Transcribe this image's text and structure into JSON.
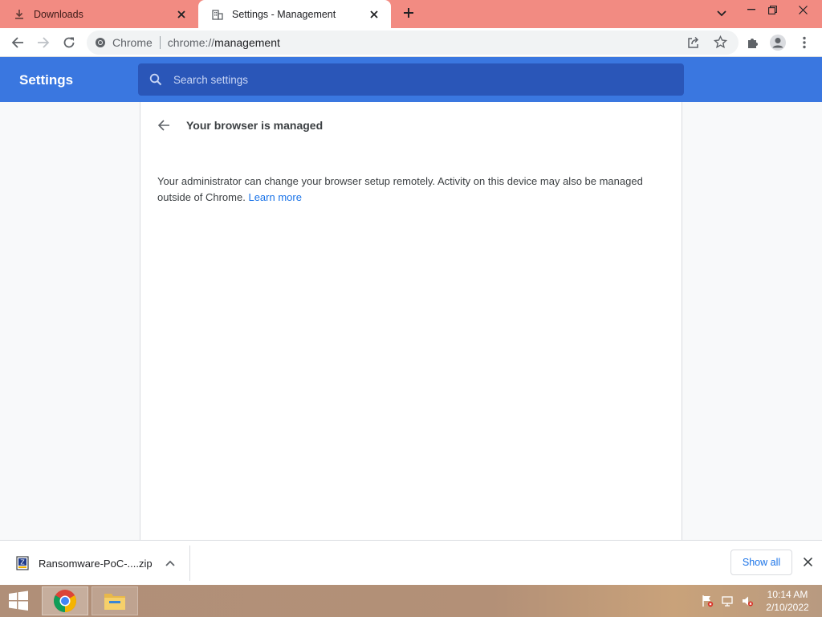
{
  "tabs": [
    {
      "title": "Downloads",
      "icon": "download-icon"
    },
    {
      "title": "Settings - Management",
      "icon": "building-icon"
    }
  ],
  "toolbar": {
    "site_label": "Chrome",
    "url_scheme": "chrome://",
    "url_path": "management"
  },
  "settings": {
    "title": "Settings",
    "search_placeholder": "Search settings"
  },
  "page": {
    "title": "Your browser is managed",
    "description": "Your administrator can change your browser setup remotely. Activity on this device may also be managed outside of Chrome.",
    "learn_more": "Learn more"
  },
  "download_shelf": {
    "item_name": "Ransomware-PoC-....zip",
    "show_all": "Show all"
  },
  "taskbar": {
    "time": "10:14 AM",
    "date": "2/10/2022"
  },
  "colors": {
    "tabstrip": "#f28b82",
    "settings_header": "#3a77e0",
    "search_box": "#2a56b8",
    "link": "#1a73e8"
  }
}
